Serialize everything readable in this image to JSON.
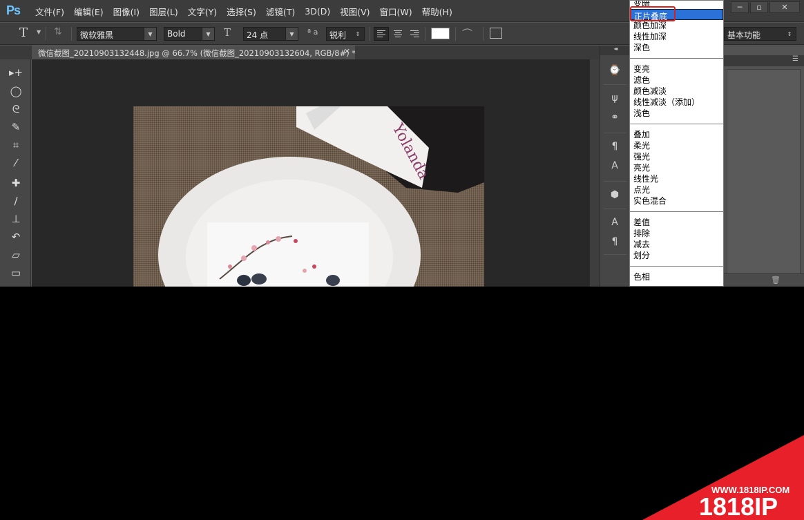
{
  "app": {
    "logo": "Ps"
  },
  "menu": [
    "文件(F)",
    "编辑(E)",
    "图像(I)",
    "图层(L)",
    "文字(Y)",
    "选择(S)",
    "滤镜(T)",
    "3D(D)",
    "视图(V)",
    "窗口(W)",
    "帮助(H)"
  ],
  "window_controls": {
    "minimize": "─",
    "restore": "▫",
    "close": "✕"
  },
  "options": {
    "tool_glyph": "T",
    "font_family": "微软雅黑",
    "font_style": "Bold",
    "font_size": "24 点",
    "aa_label": "ª a",
    "anti_alias": "锐利",
    "text_color": "#ffffff",
    "workspace": "基本功能"
  },
  "document": {
    "tab_title": "微信截图_20210903132448.jpg @ 66.7% (微信截图_20210903132604, RGB/8#) *",
    "close": "✕"
  },
  "blend_dropdown": {
    "groups": [
      [
        "变暗",
        "正片叠底",
        "颜色加深",
        "线性加深",
        "深色"
      ],
      [
        "变亮",
        "滤色",
        "颜色减淡",
        "线性减淡（添加）",
        "浅色"
      ],
      [
        "叠加",
        "柔光",
        "强光",
        "亮光",
        "线性光",
        "点光",
        "实色混合"
      ],
      [
        "差值",
        "排除",
        "减去",
        "划分"
      ],
      [
        "色相"
      ]
    ],
    "selected": "正片叠底",
    "highlight_color": "#d62020",
    "selection_color": "#2b72d8"
  },
  "watermark": {
    "url": "WWW.1818IP.COM",
    "brand": "1818IP",
    "color": "#e8202a"
  }
}
